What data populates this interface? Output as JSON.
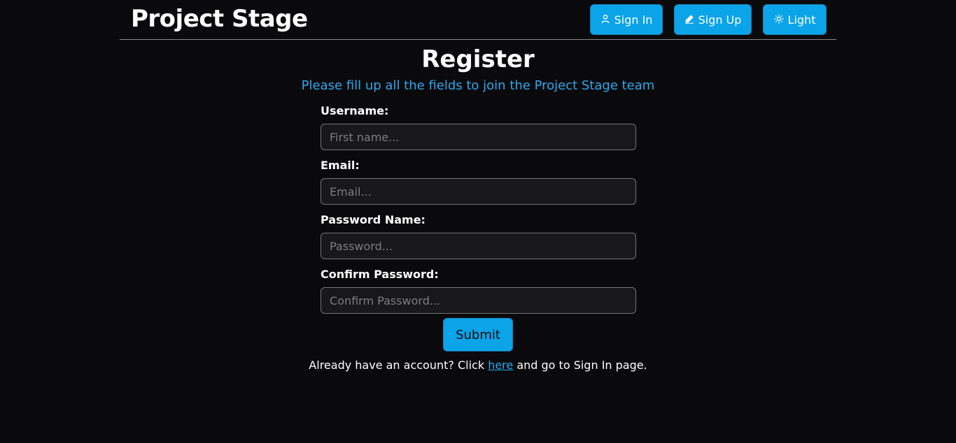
{
  "navbar": {
    "brand": "Project Stage",
    "signin_label": "Sign In",
    "signup_label": "Sign Up",
    "theme_label": "Light",
    "accent_color": "#0ba4e8"
  },
  "form": {
    "title": "Register",
    "subtitle": "Please fill up all the fields to join the Project Stage team",
    "fields": [
      {
        "label": "Username:",
        "placeholder": "First name...",
        "value": ""
      },
      {
        "label": "Email:",
        "placeholder": "Email...",
        "value": ""
      },
      {
        "label": "Password Name:",
        "placeholder": "Password...",
        "value": ""
      },
      {
        "label": "Confirm Password:",
        "placeholder": "Confirm Password...",
        "value": ""
      }
    ],
    "submit_label": "Submit"
  },
  "footer": {
    "prefix": "Already have an account? Click ",
    "link": "here",
    "suffix": " and go to Sign In page."
  },
  "icons": {
    "signin": "user-icon",
    "signup": "pencil-icon",
    "theme": "sun-icon"
  }
}
